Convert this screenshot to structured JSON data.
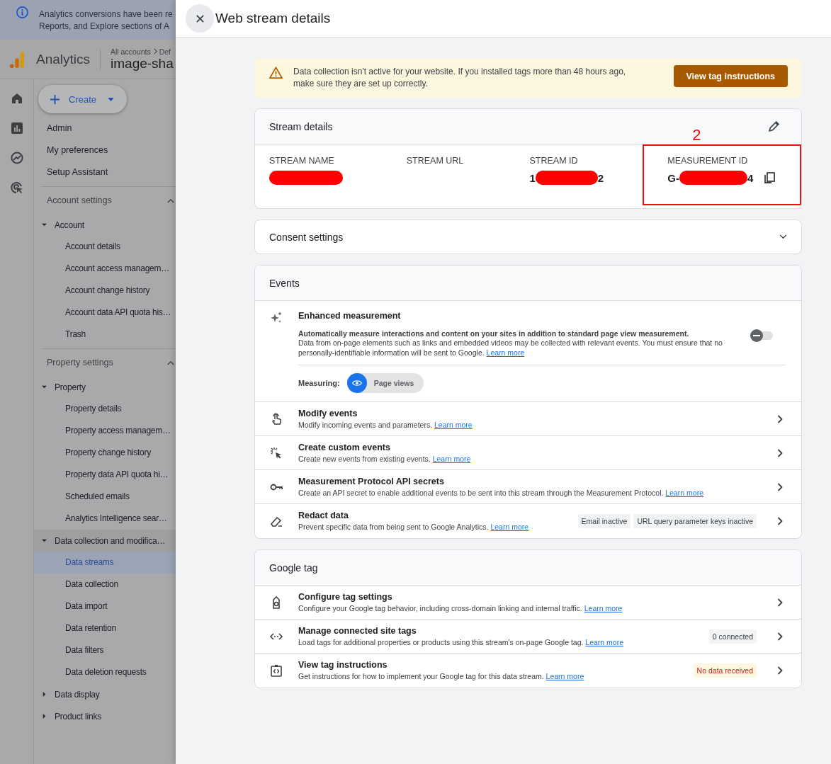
{
  "banner": {
    "lines": [
      "Analytics conversions have been re",
      "Reports, and Explore sections of A"
    ]
  },
  "app": {
    "product": "Analytics",
    "breadcrumb": [
      "All accounts",
      "Def"
    ],
    "property": "image-sha"
  },
  "create_button": {
    "label": "Create"
  },
  "nav_top": [
    "Admin",
    "My preferences",
    "Setup Assistant"
  ],
  "sections": [
    {
      "title": "Account settings",
      "expanded": true,
      "groups": [
        {
          "label": "Account",
          "expanded": true,
          "children": [
            {
              "label": "Account details",
              "selected": false
            },
            {
              "label": "Account access managem…",
              "selected": false
            },
            {
              "label": "Account change history",
              "selected": false
            },
            {
              "label": "Account data API quota his…",
              "selected": false
            },
            {
              "label": "Trash",
              "selected": false
            }
          ]
        }
      ]
    },
    {
      "title": "Property settings",
      "expanded": true,
      "groups": [
        {
          "label": "Property",
          "expanded": true,
          "children": [
            {
              "label": "Property details",
              "selected": false
            },
            {
              "label": "Property access managem…",
              "selected": false
            },
            {
              "label": "Property change history",
              "selected": false
            },
            {
              "label": "Property data API quota hi…",
              "selected": false
            },
            {
              "label": "Scheduled emails",
              "selected": false
            },
            {
              "label": "Analytics Intelligence sear…",
              "selected": false
            }
          ]
        },
        {
          "label": "Data collection and modifica…",
          "expanded": true,
          "children": [
            {
              "label": "Data streams",
              "selected": true
            },
            {
              "label": "Data collection",
              "selected": false
            },
            {
              "label": "Data import",
              "selected": false
            },
            {
              "label": "Data retention",
              "selected": false
            },
            {
              "label": "Data filters",
              "selected": false
            },
            {
              "label": "Data deletion requests",
              "selected": false
            }
          ]
        },
        {
          "label": "Data display",
          "expanded": false
        },
        {
          "label": "Product links",
          "expanded": false
        }
      ]
    }
  ],
  "panel": {
    "title": "Web stream details"
  },
  "alert": {
    "text": "Data collection isn't active for your website. If you installed tags more than 48 hours ago, make sure they are set up correctly.",
    "button": "View tag instructions"
  },
  "stream_details": {
    "title": "Stream details",
    "annotation": "2",
    "fields": [
      {
        "label": "STREAM NAME",
        "redacted": true,
        "highlighted": false
      },
      {
        "label": "STREAM URL",
        "redacted": false,
        "highlighted": false
      },
      {
        "label": "STREAM ID",
        "prefix": "1",
        "suffix": "2",
        "redacted": true,
        "highlighted": false
      },
      {
        "label": "MEASUREMENT ID",
        "prefix": "G-",
        "suffix": "4",
        "redacted": true,
        "highlighted": true,
        "copyable": true
      }
    ]
  },
  "consent": {
    "title": "Consent settings",
    "expanded": false
  },
  "events": {
    "title": "Events",
    "enhanced": {
      "title": "Enhanced measurement",
      "headline": "Automatically measure interactions and content on your sites in addition to standard page view measurement.",
      "body": "Data from on-page elements such as links and embedded videos may be collected with relevant events. You must ensure that no personally-identifiable information will be sent to Google.",
      "link": "Learn more",
      "on": false,
      "measuring_label": "Measuring:",
      "chips": [
        {
          "label": "Page views",
          "selected": true
        }
      ]
    },
    "rows": [
      {
        "title": "Modify events",
        "description": "Modify incoming events and parameters.",
        "link": "Learn more"
      },
      {
        "title": "Create custom events",
        "description": "Create new events from existing events.",
        "link": "Learn more"
      },
      {
        "title": "Measurement Protocol API secrets",
        "description": "Create an API secret to enable additional events to be sent into this stream through the Measurement Protocol.",
        "link": "Learn more"
      },
      {
        "title": "Redact data",
        "description": "Prevent specific data from being sent to Google Analytics.",
        "link": "Learn more",
        "tags": [
          {
            "label": "Email inactive",
            "kind": "neutral"
          },
          {
            "label": "URL query parameter keys inactive",
            "kind": "neutral"
          }
        ]
      }
    ]
  },
  "google_tag": {
    "title": "Google tag",
    "rows": [
      {
        "title": "Configure tag settings",
        "description": "Configure your Google tag behavior, including cross-domain linking and internal traffic.",
        "link": "Learn more"
      },
      {
        "title": "Manage connected site tags",
        "description": "Load tags for additional properties or products using this stream's on-page Google tag.",
        "link": "Learn more",
        "tags": [
          {
            "label": "0 connected",
            "kind": "neutral"
          }
        ]
      },
      {
        "title": "View tag instructions",
        "description": "Get instructions for how to implement your Google tag for this data stream.",
        "link": "Learn more",
        "tags": [
          {
            "label": "No data received",
            "kind": "warning"
          }
        ]
      }
    ]
  }
}
